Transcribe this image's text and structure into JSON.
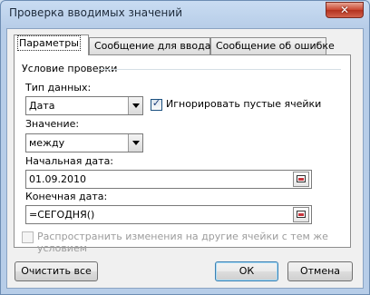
{
  "window": {
    "title": "Проверка вводимых значений",
    "close_glyph": "✕"
  },
  "tabs": [
    {
      "label": "Параметры",
      "active": true
    },
    {
      "label": "Сообщение для ввода",
      "active": false
    },
    {
      "label": "Сообщение об ошибке",
      "active": false
    }
  ],
  "criteria": {
    "group_label": "Условие проверки",
    "data_type": {
      "label": "Тип данных:",
      "value": "Дата"
    },
    "ignore_blank": {
      "label": "Игнорировать пустые ячейки",
      "checked": true,
      "mark": "✓"
    },
    "condition": {
      "label": "Значение:",
      "value": "между"
    },
    "start_date": {
      "label": "Начальная дата:",
      "value": "01.09.2010"
    },
    "end_date": {
      "label": "Конечная дата:",
      "value": "=СЕГОДНЯ()"
    }
  },
  "apply_all": {
    "label": "Распространить изменения на другие ячейки с тем же условием",
    "checked": false,
    "enabled": false
  },
  "buttons": {
    "clear_all": "Очистить все",
    "ok": "ОК",
    "cancel": "Отмена"
  }
}
